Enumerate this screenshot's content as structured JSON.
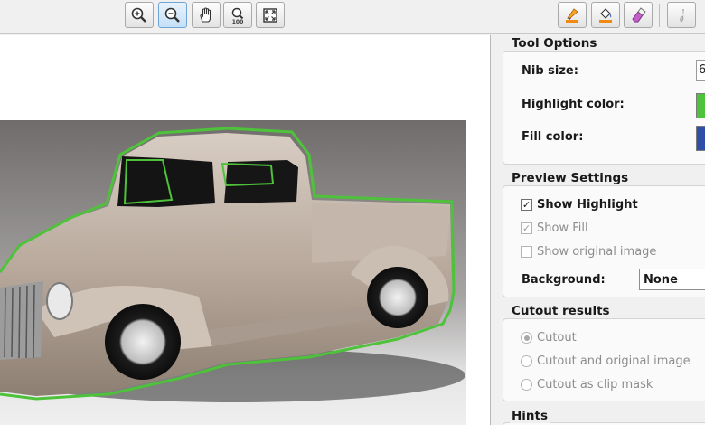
{
  "toolbar": {
    "zoom_in_icon": "magnifier-plus-icon",
    "zoom_out_icon": "magnifier-minus-icon",
    "pan_icon": "hand-icon",
    "actual_size_icon": "zoom-100-icon",
    "fit_icon": "fit-to-window-icon",
    "zoom_100_text": "100",
    "highlighter_icon": "highlighter-icon",
    "fill_icon": "paint-bucket-icon",
    "eraser_icon": "eraser-icon",
    "last_tool_icon": "brush-icon"
  },
  "tool_options": {
    "title": "Tool Options",
    "nib_size_label": "Nib size:",
    "nib_size_value": "6",
    "highlight_color_label": "Highlight color:",
    "fill_color_label": "Fill color:"
  },
  "preview_settings": {
    "title": "Preview Settings",
    "show_highlight": "Show Highlight",
    "show_fill": "Show Fill",
    "show_original": "Show original image",
    "background_label": "Background:",
    "background_value": "None"
  },
  "cutout_results": {
    "title": "Cutout results",
    "cutout": "Cutout",
    "cutout_and_original": "Cutout and original image",
    "cutout_clip_mask": "Cutout as clip mask"
  },
  "hints": {
    "title": "Hints"
  },
  "colors": {
    "highlight": "#4ec23a",
    "fill": "#2e4fa8",
    "active_tool": "#c5e0f8"
  }
}
